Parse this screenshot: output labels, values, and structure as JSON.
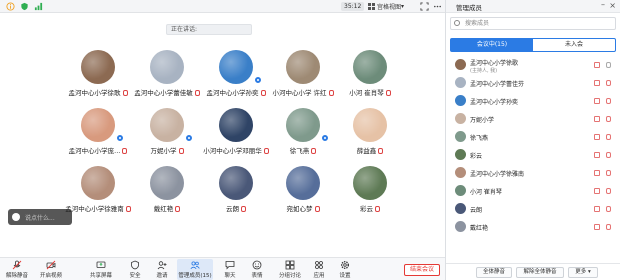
{
  "topbar": {
    "timer": "35:12",
    "view_label": "宫格视图",
    "view_arrow": "▾"
  },
  "status_text": "正在讲话:",
  "participants": [
    {
      "name": "孟河中心小学徐歌",
      "badge": false,
      "color": "#8c6a52"
    },
    {
      "name": "孟河中心小学蕾佳敏",
      "badge": false,
      "color": "#a8b3c2"
    },
    {
      "name": "孟河中心小学孙奕",
      "badge": true,
      "color": "#3a7fc8"
    },
    {
      "name": "小河中心小学 许红",
      "badge": false,
      "color": "#9e8a74"
    },
    {
      "name": "小河 崔肖琴",
      "badge": false,
      "color": "#6d8c7a"
    },
    {
      "name": "孟河中心小学庞...",
      "badge": true,
      "color": "#d89a7e"
    },
    {
      "name": "万妮小学",
      "badge": true,
      "color": "#c8b2a2"
    },
    {
      "name": "小河中心小学邓丽华",
      "badge": false,
      "color": "#2f4466"
    },
    {
      "name": "徐飞燕",
      "badge": true,
      "color": "#7f9a8c"
    },
    {
      "name": "薛益鑫",
      "badge": false,
      "color": "#e6c2a6"
    },
    {
      "name": "孟河中心小学徐雅南",
      "badge": false,
      "color": "#b48e7a"
    },
    {
      "name": "戴红艳",
      "badge": false,
      "color": "#8c93a0"
    },
    {
      "name": "云朗",
      "badge": false,
      "color": "#4a5878"
    },
    {
      "name": "宛如心梦",
      "badge": false,
      "color": "#566e9a"
    },
    {
      "name": "彩云",
      "badge": false,
      "color": "#5e7a55"
    }
  ],
  "chat_placeholder": "说点什么...",
  "toolbar": {
    "buttons": [
      {
        "label": "解除静音"
      },
      {
        "label": "开启视频"
      },
      {
        "label": "共享屏幕"
      },
      {
        "label": "安全"
      },
      {
        "label": "邀请"
      },
      {
        "label": "管理成员(15)"
      },
      {
        "label": "聊天"
      },
      {
        "label": "表情"
      },
      {
        "label": "分组讨论"
      },
      {
        "label": "应用"
      },
      {
        "label": "设置"
      }
    ],
    "end_label": "结束会议"
  },
  "panel": {
    "title": "管理成员",
    "search_placeholder": "搜索成员",
    "tab_in": "会议中(15)",
    "tab_out": "未入会",
    "members": [
      {
        "name": "孟河中心小学徐歌",
        "sub": "(主持人, 我)",
        "color": "#8c6a52",
        "host": true
      },
      {
        "name": "孟河中心小学蕾佳芬",
        "sub": "",
        "color": "#a8b3c2",
        "host": false
      },
      {
        "name": "孟河中心小学孙奕",
        "sub": "",
        "color": "#3a7fc8",
        "host": false
      },
      {
        "name": "万妮小学",
        "sub": "",
        "color": "#c8b2a2",
        "host": false
      },
      {
        "name": "徐飞燕",
        "sub": "",
        "color": "#7f9a8c",
        "host": false
      },
      {
        "name": "彩云",
        "sub": "",
        "color": "#5e7a55",
        "host": false
      },
      {
        "name": "孟河中心小学徐雅南",
        "sub": "",
        "color": "#b48e7a",
        "host": false
      },
      {
        "name": "小河 崔肖琴",
        "sub": "",
        "color": "#6d8c7a",
        "host": false
      },
      {
        "name": "云朗",
        "sub": "",
        "color": "#4a5878",
        "host": false
      },
      {
        "name": "戴红艳",
        "sub": "",
        "color": "#8c93a0",
        "host": false
      }
    ],
    "footer": {
      "mute_all": "全体静音",
      "unmute_all": "解除全体静音",
      "more": "更多 ▾"
    }
  }
}
